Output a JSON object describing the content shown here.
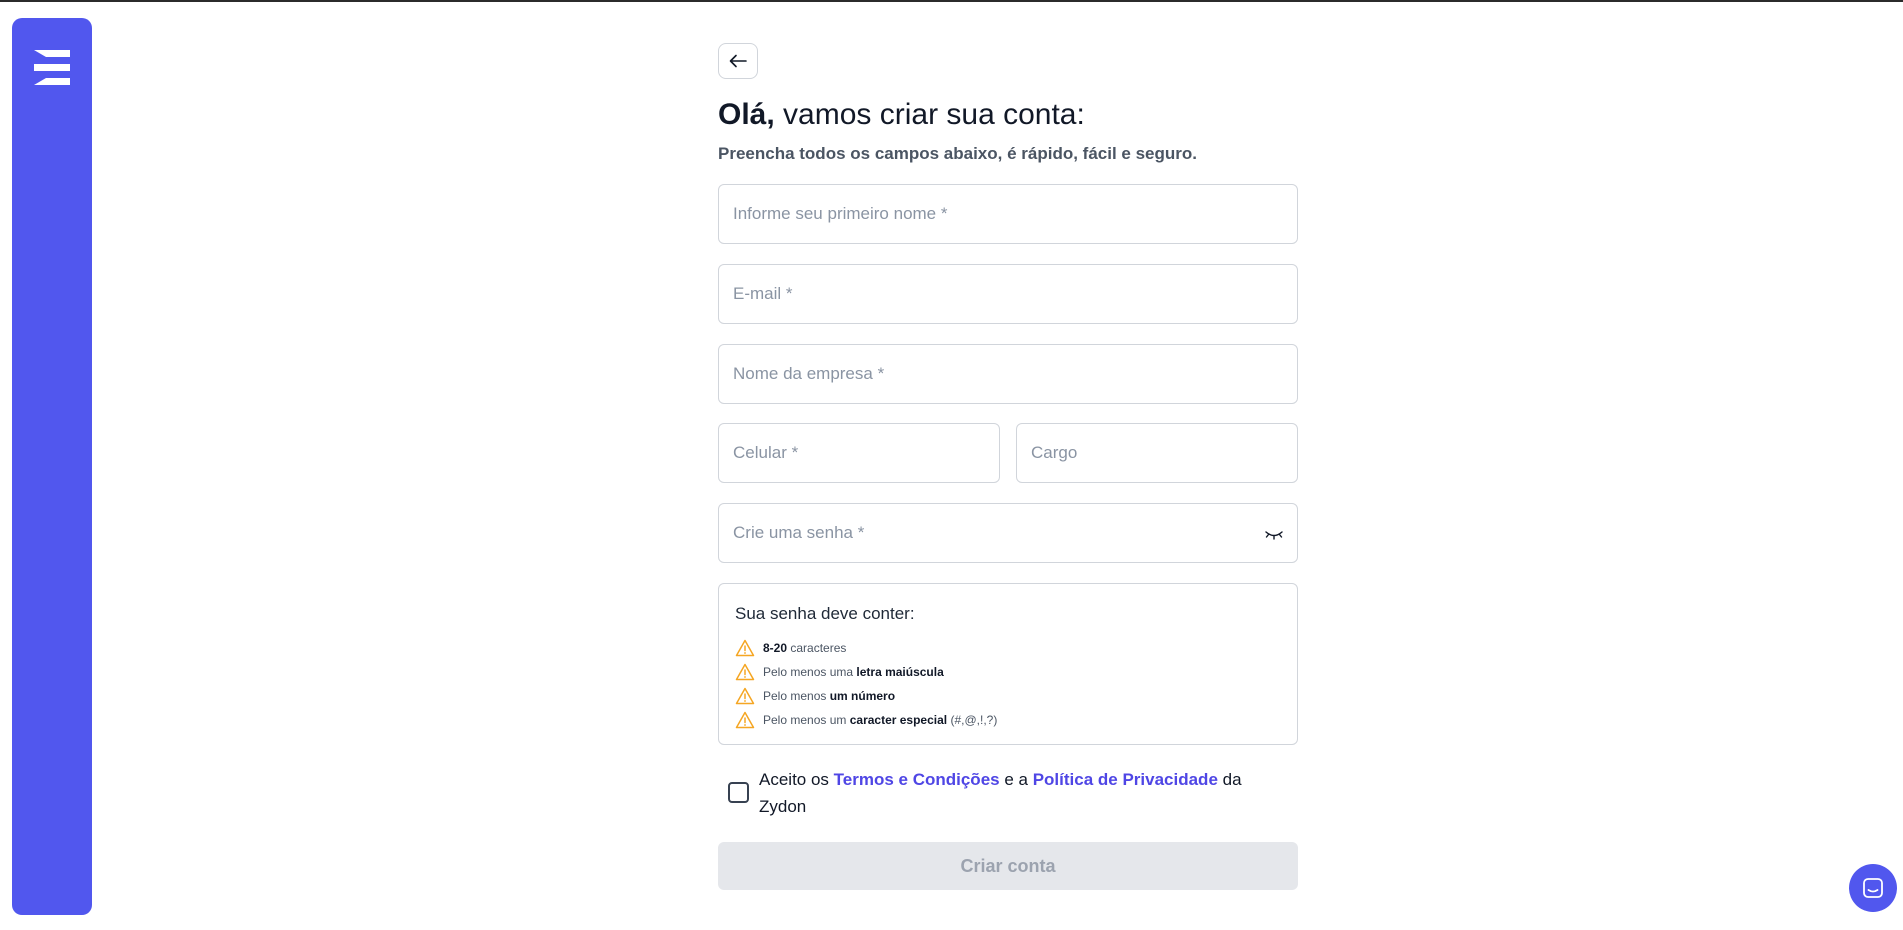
{
  "brand": {
    "sidebar_color": "#5157ee",
    "logo_icon": "zydon-logo-icon"
  },
  "header": {
    "back_icon": "arrow-left-icon",
    "title_bold": "Olá,",
    "title_rest": " vamos criar sua conta:",
    "subtitle": "Preencha todos os campos abaixo, é rápido, fácil e seguro."
  },
  "form": {
    "first_name": {
      "placeholder": "Informe seu primeiro nome *",
      "value": ""
    },
    "email": {
      "placeholder": "E-mail *",
      "value": ""
    },
    "company": {
      "placeholder": "Nome da empresa *",
      "value": ""
    },
    "phone": {
      "placeholder": "Celular *",
      "value": ""
    },
    "role": {
      "placeholder": "Cargo",
      "value": ""
    },
    "password": {
      "placeholder": "Crie uma senha *",
      "value": "",
      "toggle_icon": "eye-closed-icon"
    }
  },
  "password_rules": {
    "title": "Sua senha deve conter:",
    "status_icon": "warning-icon",
    "items": [
      {
        "bold": "8-20",
        "rest": " caracteres"
      },
      {
        "prefix": "Pelo menos uma ",
        "bold": "letra maiúscula"
      },
      {
        "prefix": "Pelo menos ",
        "bold": "um número"
      },
      {
        "prefix": "Pelo menos um ",
        "bold": "caracter especial",
        "rest": " (#,@,!,?)"
      }
    ]
  },
  "terms": {
    "prefix": "Aceito os ",
    "terms_link": "Termos e Condições",
    "middle": " e a ",
    "privacy_link": "Política de Privacidade",
    "suffix": " da Zydon",
    "checked": false
  },
  "submit": {
    "label": "Criar conta",
    "enabled": false
  },
  "support": {
    "icon": "chat-icon"
  }
}
